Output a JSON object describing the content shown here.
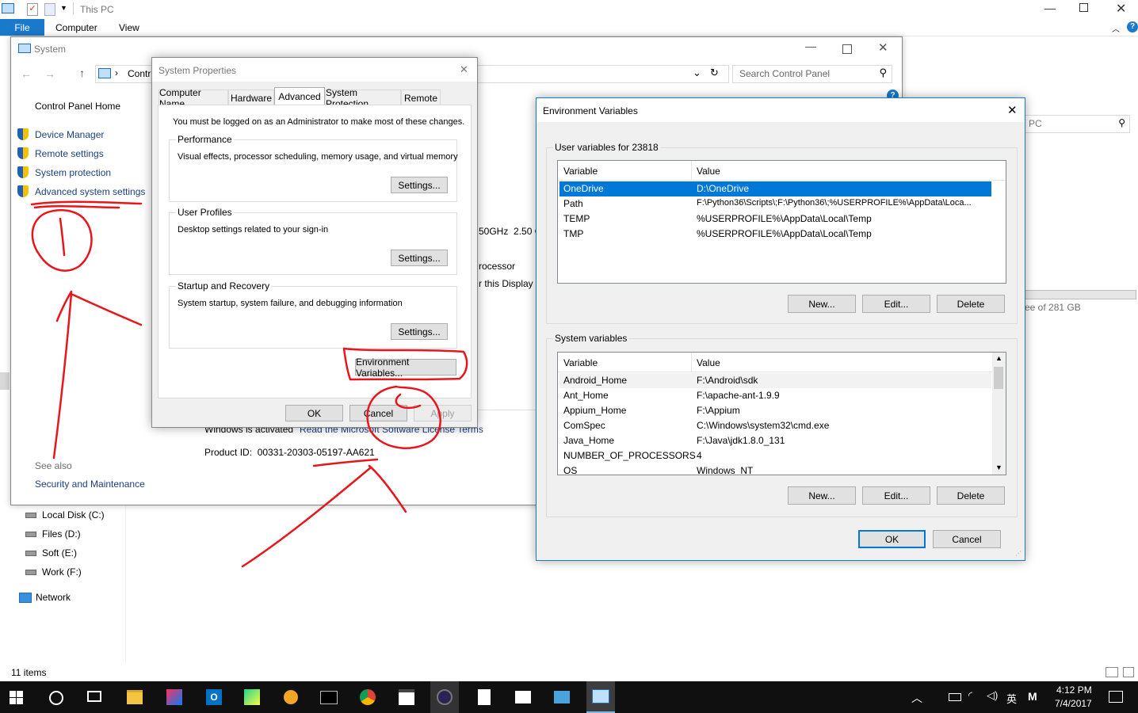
{
  "explorer": {
    "title": "This PC",
    "ribbon_tabs": [
      "File",
      "Computer",
      "View"
    ],
    "search_placeholder": "PC",
    "drives": [
      "Local Disk (C:)",
      "Files (D:)",
      "Soft (E:)",
      "Work (F:)"
    ],
    "network": "Network",
    "status": "11 items",
    "free_text": "ee of 281 GB"
  },
  "system": {
    "title": "System",
    "breadcrumb": "Contr",
    "search_placeholder": "Search Control Panel",
    "nav_home": "Control Panel Home",
    "nav_links": [
      "Device Manager",
      "Remote settings",
      "System protection",
      "Advanced system settings"
    ],
    "see_also": "See also",
    "security_link": "Security and Maintenance",
    "cpu_text": "50GHz  2.50 G",
    "processor_text": "rocessor",
    "display_text": "r this Display",
    "activated": "Windows is activated",
    "license_link": "Read the Microsoft Software License Terms",
    "product_id": "Product ID:  00331-20303-05197-AA621"
  },
  "sysprops": {
    "title": "System Properties",
    "tabs": [
      "Computer Name",
      "Hardware",
      "Advanced",
      "System Protection",
      "Remote"
    ],
    "admin_note": "You must be logged on as an Administrator to make most of these changes.",
    "performance": {
      "label": "Performance",
      "desc": "Visual effects, processor scheduling, memory usage, and virtual memory",
      "button": "Settings..."
    },
    "profiles": {
      "label": "User Profiles",
      "desc": "Desktop settings related to your sign-in",
      "button": "Settings..."
    },
    "startup": {
      "label": "Startup and Recovery",
      "desc": "System startup, system failure, and debugging information",
      "button": "Settings..."
    },
    "env_button": "Environment Variables...",
    "ok": "OK",
    "cancel": "Cancel",
    "apply": "Apply"
  },
  "envvars": {
    "title": "Environment Variables",
    "user_label": "User variables for 23818",
    "col_variable": "Variable",
    "col_value": "Value",
    "user_rows": [
      {
        "name": "OneDrive",
        "value": "D:\\OneDrive"
      },
      {
        "name": "Path",
        "value": "F:\\Python36\\Scripts\\;F:\\Python36\\;%USERPROFILE%\\AppData\\Loca..."
      },
      {
        "name": "TEMP",
        "value": "%USERPROFILE%\\AppData\\Local\\Temp"
      },
      {
        "name": "TMP",
        "value": "%USERPROFILE%\\AppData\\Local\\Temp"
      }
    ],
    "system_label": "System variables",
    "system_rows": [
      {
        "name": "Android_Home",
        "value": "F:\\Android\\sdk"
      },
      {
        "name": "Ant_Home",
        "value": "F:\\apache-ant-1.9.9"
      },
      {
        "name": "Appium_Home",
        "value": "F:\\Appium"
      },
      {
        "name": "ComSpec",
        "value": "C:\\Windows\\system32\\cmd.exe"
      },
      {
        "name": "Java_Home",
        "value": "F:\\Java\\jdk1.8.0_131"
      },
      {
        "name": "NUMBER_OF_PROCESSORS",
        "value": "4"
      },
      {
        "name": "OS",
        "value": "Windows_NT"
      }
    ],
    "new": "New...",
    "edit": "Edit...",
    "delete": "Delete",
    "ok": "OK",
    "cancel": "Cancel"
  },
  "taskbar": {
    "time": "4:12 PM",
    "date": "7/4/2017",
    "ime": "英",
    "ime2": "M"
  },
  "accent": "#0078d7",
  "annotation_color": "#e8161b"
}
